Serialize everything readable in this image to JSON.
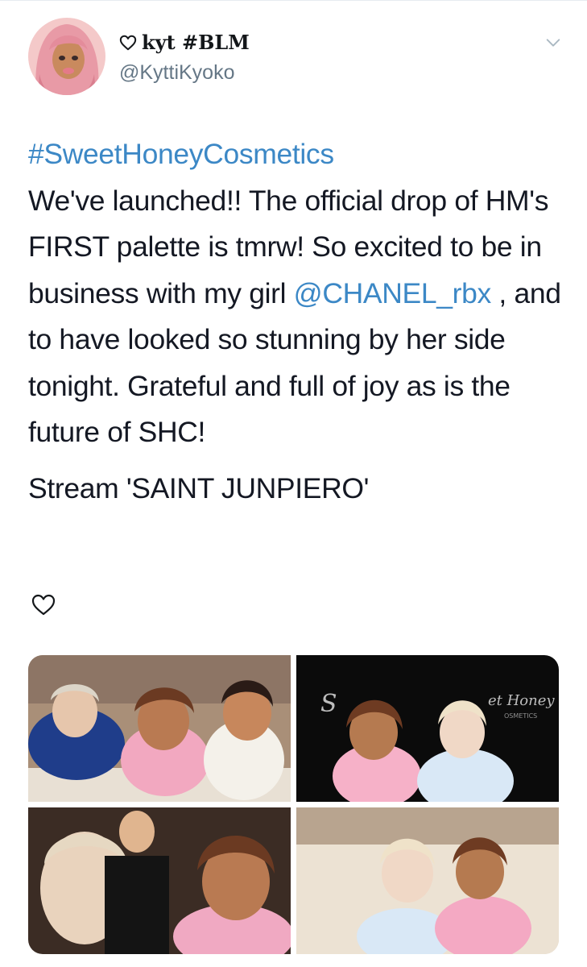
{
  "tweet": {
    "display_name": "kyt #BLM",
    "handle": "@KyttiKyoko",
    "hashtag": "#SweetHoneyCosmetics",
    "body_part1": "We've launched!! The official drop of HM's FIRST palette is tmrw! So excited to be in business with my girl ",
    "mention": "@CHANEL_rbx",
    "body_part2": " , and to have looked so stunning by her side tonight. Grateful and full of joy as is the future of SHC!",
    "stream_line": "Stream 'SAINT JUNPIERO'"
  },
  "icons": {
    "name_prefix": "heart-outline-icon",
    "menu": "chevron-down-icon",
    "like": "heart-outline-icon"
  },
  "media": {
    "count": 4,
    "watermark_left": "S",
    "watermark_right": "et Honey",
    "watermark_sub": "OSMETICS"
  },
  "colors": {
    "link": "#3c88c6",
    "text": "#141823",
    "secondary": "#657786"
  }
}
